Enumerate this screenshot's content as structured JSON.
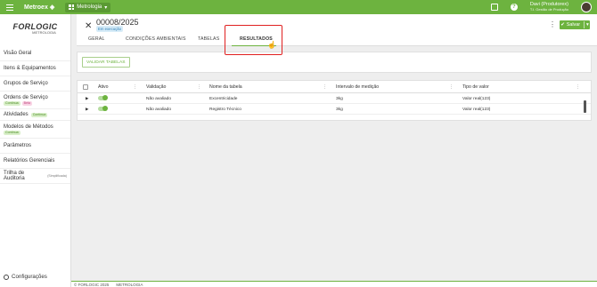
{
  "topbar": {
    "brand": "Metroex",
    "module_label": "Metrologia",
    "user_name": "Davi (Produtorex)",
    "user_role": "T.I. Gestão de Produção"
  },
  "logo": {
    "text": "FORLOGIC",
    "subtext": "METROLOGIA"
  },
  "sidebar": {
    "items": [
      {
        "label": "Visão Geral"
      },
      {
        "label": "Itens & Equipamentos"
      },
      {
        "label": "Grupos de Serviço"
      },
      {
        "label": "Ordens de Serviço",
        "badges": [
          "Contínua",
          "Beta"
        ]
      },
      {
        "label": "Atividades",
        "badges": [
          "Contínua"
        ]
      },
      {
        "label": "Modelos de Métodos",
        "badges": [
          "Contínua"
        ]
      },
      {
        "label": "Parâmetros"
      },
      {
        "label": "Relatórios Gerenciais"
      },
      {
        "label": "Trilha de Auditoria",
        "hint": "(Simplificada)"
      }
    ],
    "config_label": "Configurações"
  },
  "header": {
    "title": "00008/2025",
    "status": "Em execução",
    "tabs": [
      "GERAL",
      "CONDIÇÕES AMBIENTAIS",
      "TABELAS",
      "RESULTADOS"
    ],
    "active_tab": "RESULTADOS",
    "save_label": "Salvar"
  },
  "panel": {
    "validar_label": "VALIDAR TABELAS"
  },
  "table": {
    "columns": [
      "Ativo",
      "Validação",
      "Nome da tabela",
      "Intervalo de medição",
      "Tipo de valor"
    ],
    "rows": [
      {
        "validacao": "Não avaliado",
        "nome": "Excentricidade",
        "intervalo": "3kg",
        "tipo": "Valor real(123)"
      },
      {
        "validacao": "Não avaliado",
        "nome": "Registro Técnico",
        "intervalo": "3kg",
        "tipo": "Valor real(123)"
      }
    ]
  },
  "footer": {
    "copyright": "© FORLOGIC 2025",
    "module": "METROLOGIA"
  },
  "colors": {
    "accent": "#6db33f",
    "highlight": "#e02020"
  },
  "icons": [
    "menu-icon",
    "grid-icon",
    "chevron-down-icon",
    "edit-icon",
    "help-icon",
    "close-icon",
    "kebab-icon",
    "check-icon",
    "gear-icon",
    "hand-cursor-icon"
  ]
}
